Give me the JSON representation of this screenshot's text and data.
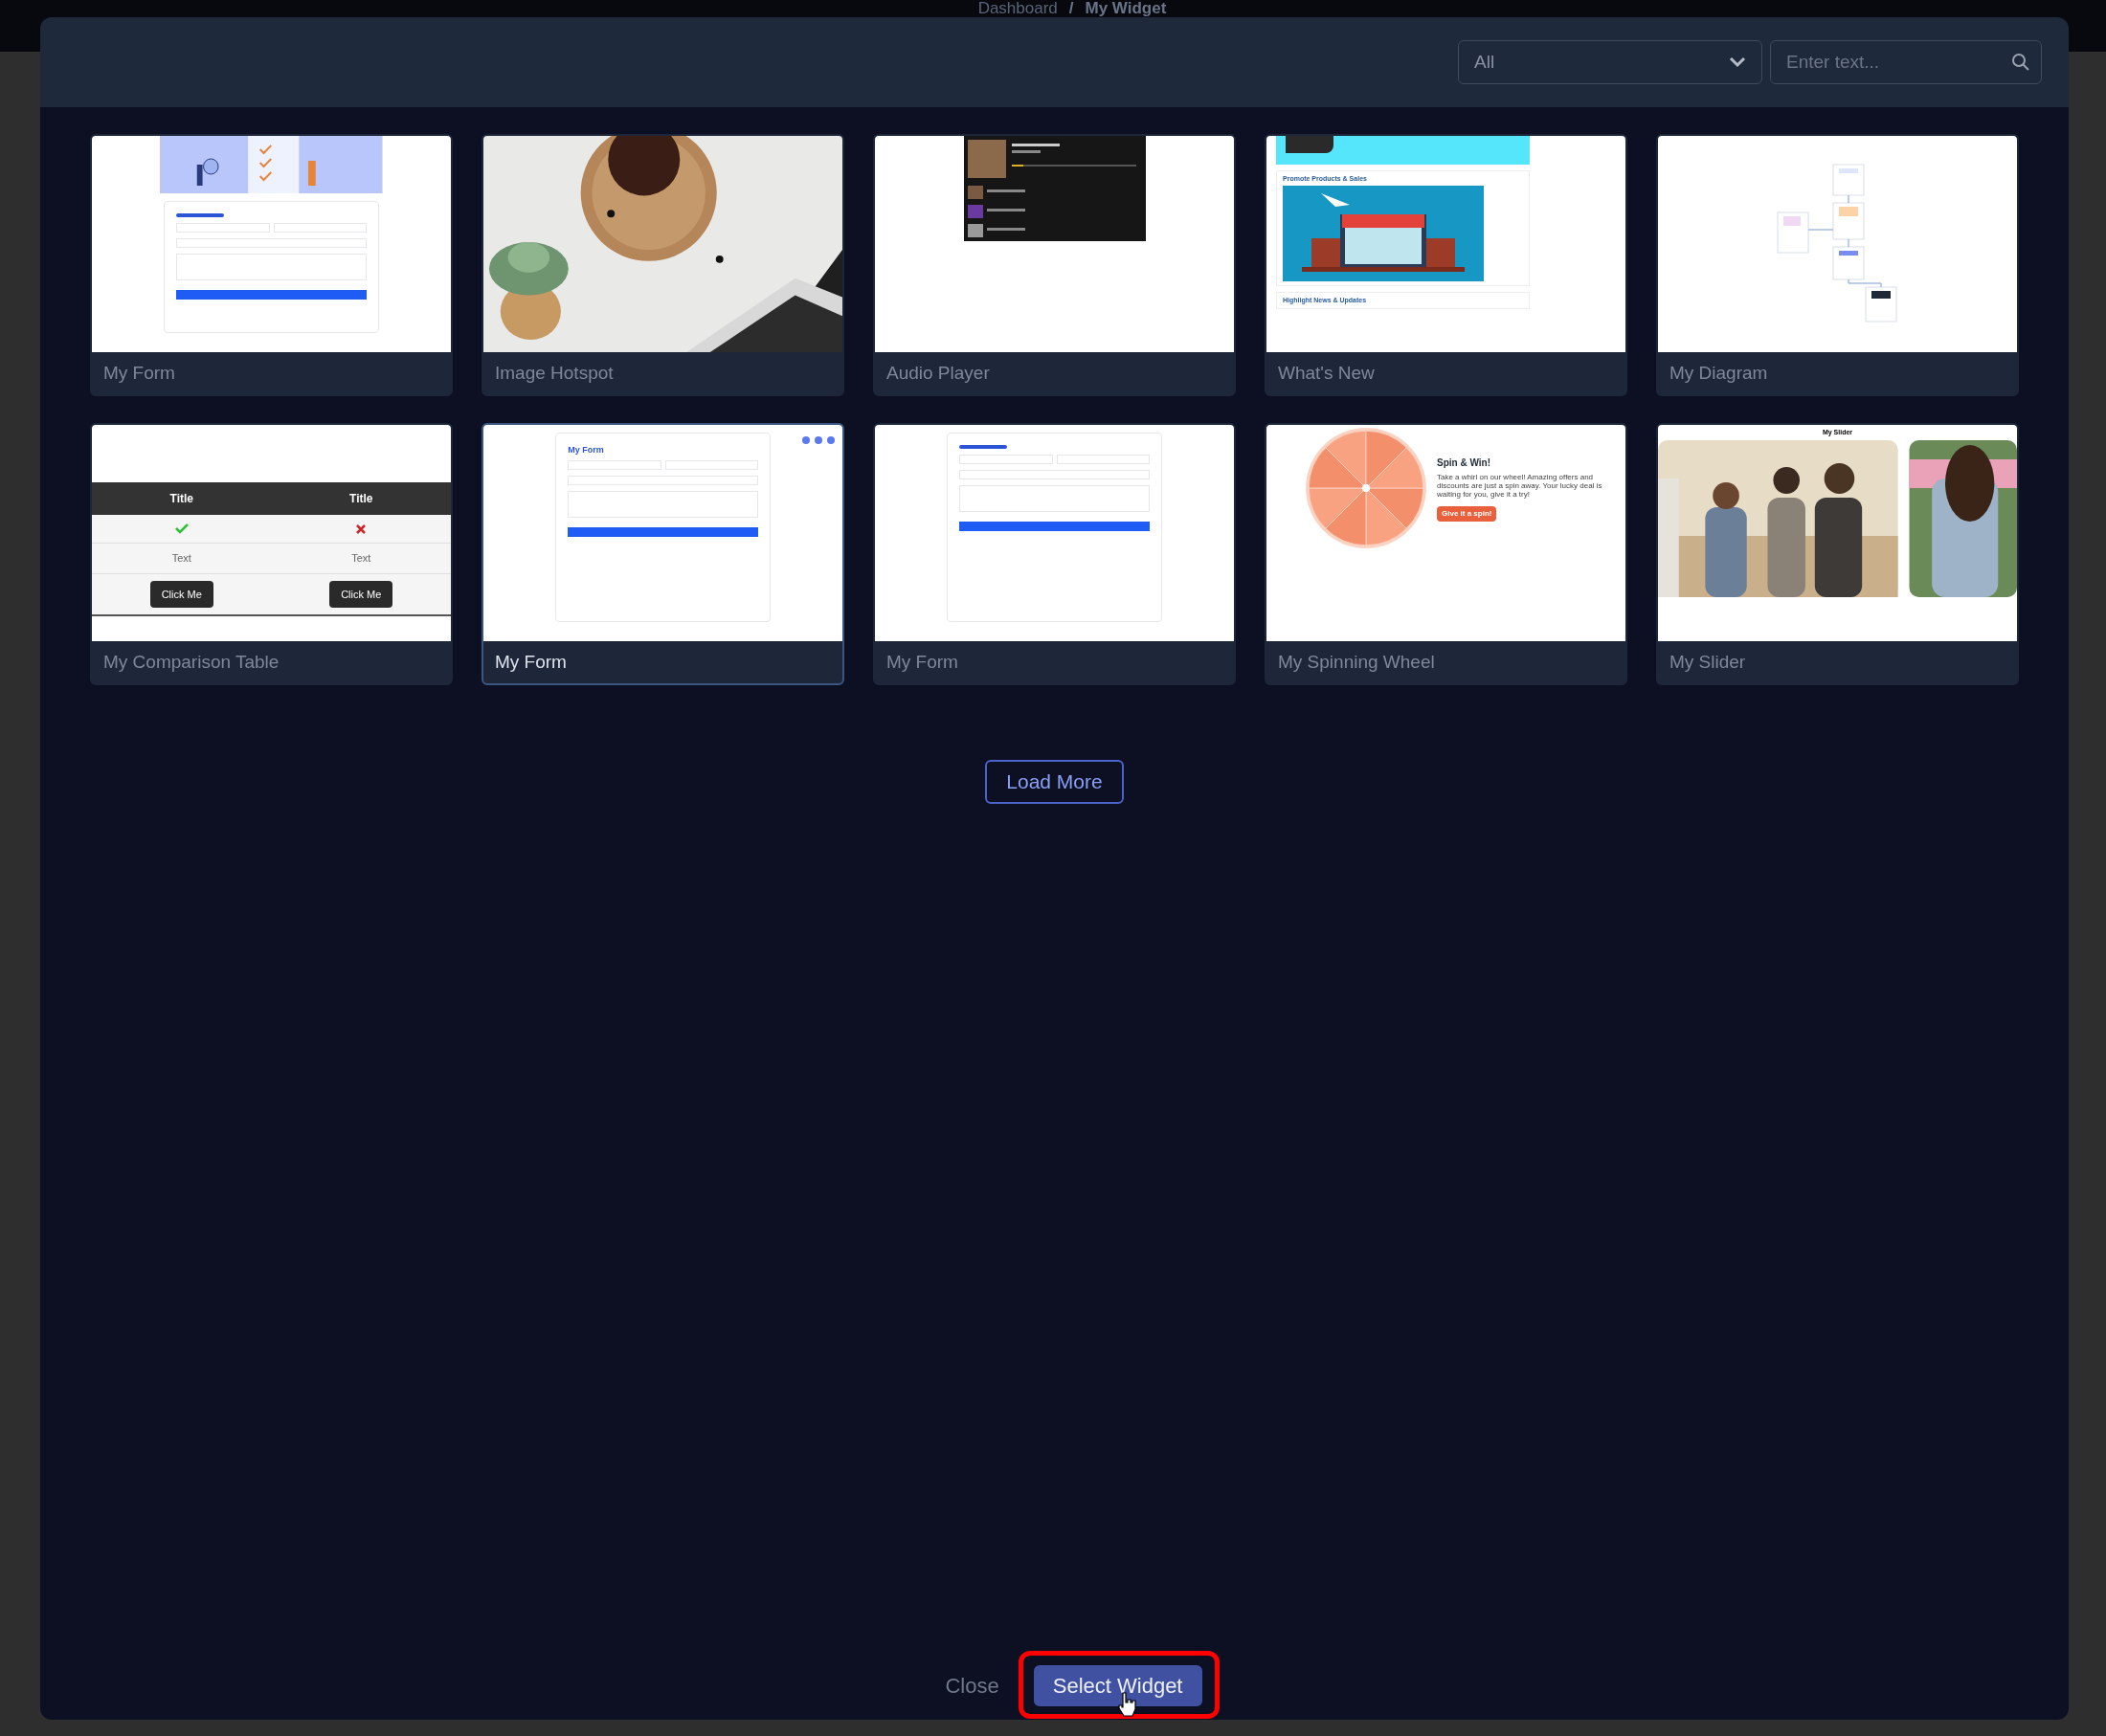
{
  "breadcrumb": {
    "items": [
      "Dashboard",
      "My Widget"
    ],
    "separator": "/"
  },
  "filter": {
    "value": "All"
  },
  "search": {
    "placeholder": "Enter text..."
  },
  "widgets": [
    {
      "title": "My Form",
      "selected": false,
      "preview": {
        "kind": "form",
        "banner": true
      }
    },
    {
      "title": "Image Hotspot",
      "selected": false
    },
    {
      "title": "Audio Player",
      "selected": false,
      "preview": {
        "kind": "audio"
      }
    },
    {
      "title": "What's New",
      "selected": false,
      "preview": {
        "kind": "news",
        "headings": [
          "Promote Products & Sales",
          "Highlight News & Updates"
        ]
      }
    },
    {
      "title": "My Diagram",
      "selected": false,
      "preview": {
        "kind": "diagram"
      }
    },
    {
      "title": "My Comparison Table",
      "selected": false,
      "preview": {
        "kind": "table",
        "headers": [
          "Title",
          "Title"
        ],
        "cells": [
          "Text",
          "Text"
        ],
        "buttons": [
          "Click Me",
          "Click Me"
        ]
      }
    },
    {
      "title": "My Form",
      "selected": true,
      "preview": {
        "kind": "form",
        "title": "My Form",
        "dots": true
      }
    },
    {
      "title": "My Form",
      "selected": false,
      "preview": {
        "kind": "form"
      }
    },
    {
      "title": "My Spinning Wheel",
      "selected": false,
      "preview": {
        "kind": "wheel",
        "heading": "Spin & Win!",
        "text": "Take a whirl on our wheel! Amazing offers and discounts are just a spin away. Your lucky deal is waiting for you, give it a try!",
        "button": "Give it a spin!"
      }
    },
    {
      "title": "My Slider",
      "selected": false,
      "preview": {
        "kind": "slider",
        "title": "My Slider"
      }
    }
  ],
  "load_more": "Load More",
  "footer": {
    "close": "Close",
    "select": "Select Widget"
  }
}
